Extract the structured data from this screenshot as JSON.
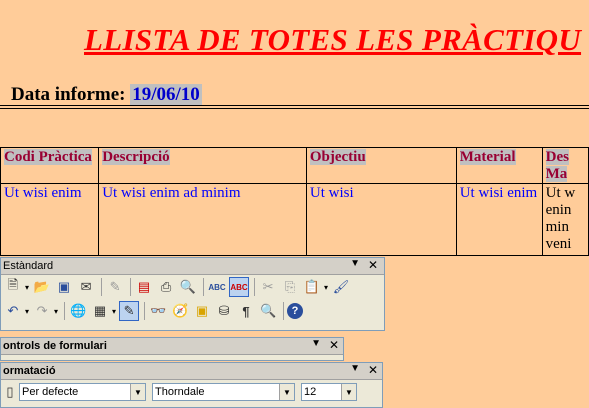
{
  "report": {
    "title": "LLISTA DE TOTES LES PRÀCTIQU",
    "date_label": "Data informe:",
    "date_value": "19/06/10",
    "headers": [
      "Codi Pràctica",
      "Descripció",
      "Objectiu",
      "Material",
      "Des Ma"
    ],
    "row": [
      "Ut wisi enim",
      "Ut wisi enim ad minim",
      "Ut wisi",
      "Ut wisi enim",
      "Ut w enin min veni"
    ]
  },
  "toolbar_standard": {
    "title": "Estàndard",
    "menu_arrow": "▼",
    "close": "✕"
  },
  "toolbar_forms": {
    "title": "ontrols de formulari",
    "menu_arrow": "▼",
    "close": "✕"
  },
  "toolbar_format": {
    "title": "ormatació",
    "menu_arrow": "▼",
    "close": "✕",
    "style_value": "Per defecte",
    "font_value": "Thorndale",
    "size_value": "12"
  }
}
